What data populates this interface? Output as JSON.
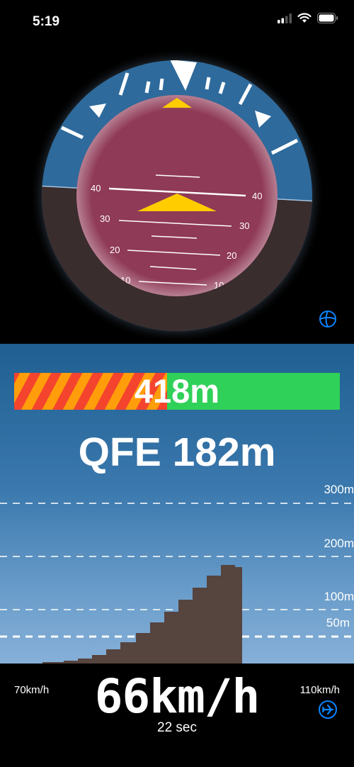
{
  "status_bar": {
    "time": "5:19",
    "icons": [
      "cellular-signal-icon",
      "wifi-icon",
      "battery-icon"
    ]
  },
  "attitude_indicator": {
    "pitch_scale_labels": [
      "40",
      "30",
      "20",
      "10"
    ],
    "sky_color": "#2e6a9c",
    "ground_color": "#3a2d2d",
    "inner_sky_color": "#8f3a57",
    "aircraft_symbol_color": "#ffcc00",
    "globe_button_icon": "globe-icon"
  },
  "altitude": {
    "agl_value": "418m",
    "agl_danger_fraction": 0.47,
    "danger_colors": [
      "#f4442e",
      "#ff9d0a"
    ],
    "safe_color": "#30d158",
    "qfe_text": "QFE 182m"
  },
  "profile": {
    "reference_lines": [
      "300m",
      "200m",
      "100m",
      "50m"
    ],
    "terrain_color": "#56443f"
  },
  "speed": {
    "min_label": "70km/h",
    "max_label": "110km/h",
    "current": "66km/h",
    "duration": "22 sec",
    "plane_button_icon": "airplane-icon",
    "accent_color": "#0a84ff"
  }
}
